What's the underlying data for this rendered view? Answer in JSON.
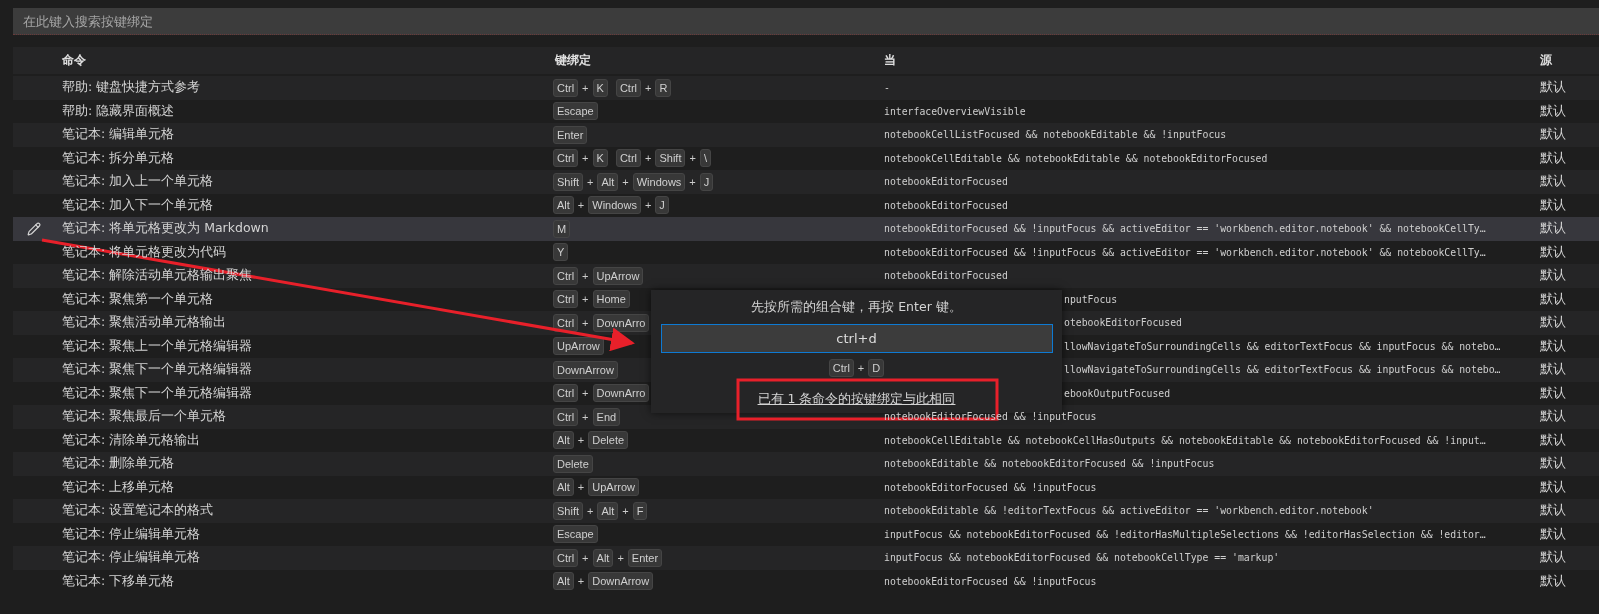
{
  "search": {
    "placeholder": "在此键入搜索按键绑定"
  },
  "columns": [
    "命令",
    "键绑定",
    "当",
    "源"
  ],
  "rows": [
    {
      "command": "帮助: 键盘快捷方式参考",
      "keybinding": [
        {
          "keys": [
            "Ctrl",
            "K"
          ],
          "joiner": "+"
        },
        {
          "keys": [
            "Ctrl",
            "R"
          ],
          "joiner": "+"
        }
      ],
      "when": "-",
      "covered": false,
      "source": "默认",
      "selected": false
    },
    {
      "command": "帮助: 隐藏界面概述",
      "keybinding": [
        {
          "keys": [
            "Escape"
          ]
        }
      ],
      "when": "interfaceOverviewVisible",
      "covered": false,
      "source": "默认",
      "selected": false
    },
    {
      "command": "笔记本: 编辑单元格",
      "keybinding": [
        {
          "keys": [
            "Enter"
          ]
        }
      ],
      "when": "notebookCellListFocused && notebookEditable && !inputFocus",
      "covered": false,
      "source": "默认",
      "selected": false
    },
    {
      "command": "笔记本: 拆分单元格",
      "keybinding": [
        {
          "keys": [
            "Ctrl",
            "K"
          ],
          "joiner": "+"
        },
        {
          "keys": [
            "Ctrl",
            "Shift",
            "\\"
          ],
          "joiner": "+"
        }
      ],
      "when": "notebookCellEditable && notebookEditable && notebookEditorFocused",
      "covered": false,
      "source": "默认",
      "selected": false
    },
    {
      "command": "笔记本: 加入上一个单元格",
      "keybinding": [
        {
          "keys": [
            "Shift",
            "Alt",
            "Windows",
            "J"
          ],
          "joiner": "+"
        }
      ],
      "when": "notebookEditorFocused",
      "covered": false,
      "source": "默认",
      "selected": false
    },
    {
      "command": "笔记本: 加入下一个单元格",
      "keybinding": [
        {
          "keys": [
            "Alt",
            "Windows",
            "J"
          ],
          "joiner": "+"
        }
      ],
      "when": "notebookEditorFocused",
      "covered": false,
      "source": "默认",
      "selected": false
    },
    {
      "command": "笔记本: 将单元格更改为 Markdown",
      "keybinding": [
        {
          "keys": [
            "M"
          ]
        }
      ],
      "when": "notebookEditorFocused && !inputFocus && activeEditor == 'workbench.editor.notebook' && notebookCellTy…",
      "covered": false,
      "source": "默认",
      "selected": true
    },
    {
      "command": "笔记本: 将单元格更改为代码",
      "keybinding": [
        {
          "keys": [
            "Y"
          ]
        }
      ],
      "when": "notebookEditorFocused && !inputFocus && activeEditor == 'workbench.editor.notebook' && notebookCellTy…",
      "covered": false,
      "source": "默认",
      "selected": false
    },
    {
      "command": "笔记本: 解除活动单元格输出聚焦",
      "keybinding": [
        {
          "keys": [
            "Ctrl",
            "UpArrow"
          ],
          "joiner": "+"
        }
      ],
      "when": "notebookEditorFocused",
      "covered": false,
      "source": "默认",
      "selected": false
    },
    {
      "command": "笔记本: 聚焦第一个单元格",
      "keybinding": [
        {
          "keys": [
            "Ctrl",
            "Home"
          ],
          "joiner": "+"
        }
      ],
      "when": "nputFocus",
      "covered": true,
      "source": "默认",
      "selected": false
    },
    {
      "command": "笔记本: 聚焦活动单元格输出",
      "keybinding": [
        {
          "keys": [
            "Ctrl",
            "DownArro"
          ],
          "joiner": "+"
        }
      ],
      "when": "otebookEditorFocused",
      "covered": true,
      "source": "默认",
      "selected": false
    },
    {
      "command": "笔记本: 聚焦上一个单元格编辑器",
      "keybinding": [
        {
          "keys": [
            "UpArrow"
          ]
        }
      ],
      "when": "llowNavigateToSurroundingCells && editorTextFocus && inputFocus && notebo…",
      "covered": true,
      "source": "默认",
      "selected": false
    },
    {
      "command": "笔记本: 聚焦下一个单元格编辑器",
      "keybinding": [
        {
          "keys": [
            "DownArrow"
          ]
        }
      ],
      "when": "llowNavigateToSurroundingCells && editorTextFocus && inputFocus && notebo…",
      "covered": true,
      "source": "默认",
      "selected": false
    },
    {
      "command": "笔记本: 聚焦下一个单元格编辑器",
      "keybinding": [
        {
          "keys": [
            "Ctrl",
            "DownArro"
          ],
          "joiner": "+"
        }
      ],
      "when": "ebookOutputFocused",
      "covered": true,
      "source": "默认",
      "selected": false
    },
    {
      "command": "笔记本: 聚焦最后一个单元格",
      "keybinding": [
        {
          "keys": [
            "Ctrl",
            "End"
          ],
          "joiner": "+"
        }
      ],
      "when": "notebookEditorFocused && !inputFocus",
      "covered": false,
      "source": "默认",
      "selected": false
    },
    {
      "command": "笔记本: 清除单元格输出",
      "keybinding": [
        {
          "keys": [
            "Alt",
            "Delete"
          ],
          "joiner": "+"
        }
      ],
      "when": "notebookCellEditable && notebookCellHasOutputs && notebookEditable && notebookEditorFocused && !input…",
      "covered": false,
      "source": "默认",
      "selected": false
    },
    {
      "command": "笔记本: 删除单元格",
      "keybinding": [
        {
          "keys": [
            "Delete"
          ]
        }
      ],
      "when": "notebookEditable && notebookEditorFocused && !inputFocus",
      "covered": false,
      "source": "默认",
      "selected": false
    },
    {
      "command": "笔记本: 上移单元格",
      "keybinding": [
        {
          "keys": [
            "Alt",
            "UpArrow"
          ],
          "joiner": "+"
        }
      ],
      "when": "notebookEditorFocused && !inputFocus",
      "covered": false,
      "source": "默认",
      "selected": false
    },
    {
      "command": "笔记本: 设置笔记本的格式",
      "keybinding": [
        {
          "keys": [
            "Shift",
            "Alt",
            "F"
          ],
          "joiner": "+"
        }
      ],
      "when": "notebookEditable && !editorTextFocus && activeEditor == 'workbench.editor.notebook'",
      "covered": false,
      "source": "默认",
      "selected": false
    },
    {
      "command": "笔记本: 停止编辑单元格",
      "keybinding": [
        {
          "keys": [
            "Escape"
          ]
        }
      ],
      "when": "inputFocus && notebookEditorFocused && !editorHasMultipleSelections && !editorHasSelection && !editor…",
      "covered": false,
      "source": "默认",
      "selected": false
    },
    {
      "command": "笔记本: 停止编辑单元格",
      "keybinding": [
        {
          "keys": [
            "Ctrl",
            "Alt",
            "Enter"
          ],
          "joiner": "+"
        }
      ],
      "when": "inputFocus && notebookEditorFocused && notebookCellType == 'markup'",
      "covered": false,
      "source": "默认",
      "selected": false
    },
    {
      "command": "笔记本: 下移单元格",
      "keybinding": [
        {
          "keys": [
            "Alt",
            "DownArrow"
          ],
          "joiner": "+"
        }
      ],
      "when": "notebookEditorFocused && !inputFocus",
      "covered": false,
      "source": "默认",
      "selected": false
    }
  ],
  "dialog": {
    "prompt": "先按所需的组合键，再按 Enter 键。",
    "value": "ctrl+d",
    "keybinding": {
      "keys": [
        "Ctrl",
        "D"
      ],
      "joiner": "+"
    },
    "conflict_link": "已有 1 条命令的按键绑定与此相同"
  }
}
